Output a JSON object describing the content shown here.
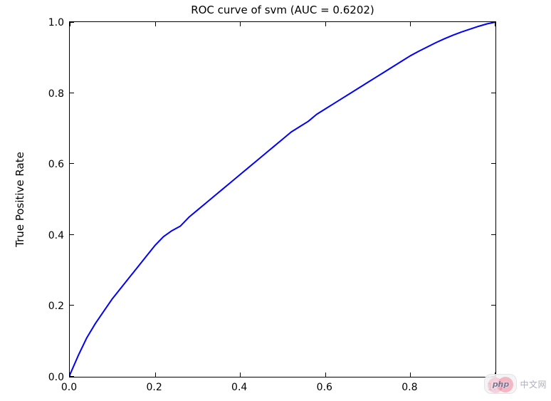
{
  "chart_data": {
    "type": "line",
    "title": "ROC curve of svm (AUC = 0.6202)",
    "ylabel": "True Positive Rate",
    "xlabel": "",
    "xlim": [
      0.0,
      1.0
    ],
    "ylim": [
      0.0,
      1.0
    ],
    "xticks": [
      0.0,
      0.2,
      0.4,
      0.6,
      0.8,
      1.0
    ],
    "yticks": [
      0.0,
      0.2,
      0.4,
      0.6,
      0.8,
      1.0
    ],
    "line_color": "#0000ff",
    "series": [
      {
        "name": "ROC",
        "x": [
          0.0,
          0.02,
          0.04,
          0.06,
          0.08,
          0.1,
          0.12,
          0.14,
          0.16,
          0.18,
          0.2,
          0.22,
          0.24,
          0.26,
          0.28,
          0.3,
          0.32,
          0.34,
          0.36,
          0.38,
          0.4,
          0.42,
          0.44,
          0.46,
          0.48,
          0.5,
          0.52,
          0.54,
          0.56,
          0.58,
          0.6,
          0.62,
          0.64,
          0.66,
          0.68,
          0.7,
          0.72,
          0.74,
          0.76,
          0.78,
          0.8,
          0.82,
          0.84,
          0.86,
          0.88,
          0.9,
          0.92,
          0.94,
          0.96,
          0.98,
          1.0
        ],
        "y": [
          0.005,
          0.06,
          0.11,
          0.15,
          0.185,
          0.22,
          0.25,
          0.28,
          0.31,
          0.34,
          0.37,
          0.395,
          0.412,
          0.425,
          0.45,
          0.47,
          0.49,
          0.51,
          0.53,
          0.55,
          0.57,
          0.59,
          0.61,
          0.63,
          0.65,
          0.67,
          0.69,
          0.705,
          0.72,
          0.74,
          0.755,
          0.77,
          0.785,
          0.8,
          0.815,
          0.83,
          0.845,
          0.86,
          0.875,
          0.89,
          0.905,
          0.918,
          0.93,
          0.942,
          0.953,
          0.963,
          0.972,
          0.98,
          0.988,
          0.995,
          1.0
        ]
      }
    ]
  },
  "xtick_labels": [
    "0.0",
    "0.2",
    "0.4",
    "0.6",
    "0.8",
    "1.0"
  ],
  "ytick_labels": [
    "0.0",
    "0.2",
    "0.4",
    "0.6",
    "0.8",
    "1.0"
  ],
  "watermark": {
    "badge_text": "php",
    "tail_text": "中文网"
  }
}
